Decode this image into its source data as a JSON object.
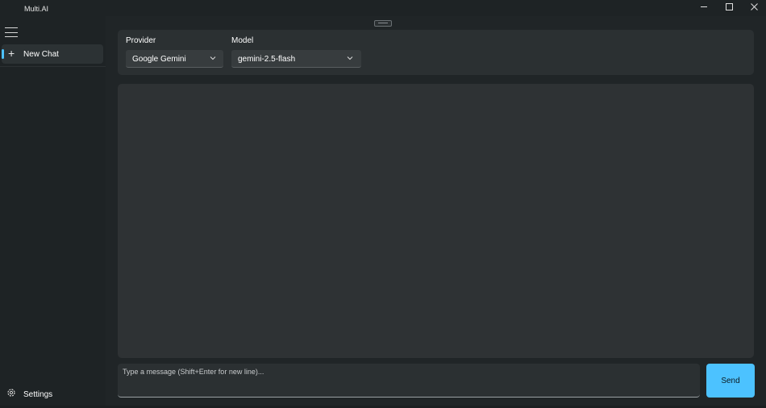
{
  "window": {
    "title": "Multi.AI"
  },
  "sidebar": {
    "items": [
      {
        "label": "New Chat",
        "icon": "plus-icon",
        "selected": true
      }
    ],
    "settings_label": "Settings"
  },
  "selectors": {
    "provider": {
      "label": "Provider",
      "value": "Google Gemini"
    },
    "model": {
      "label": "Model",
      "value": "gemini-2.5-flash"
    }
  },
  "composer": {
    "placeholder": "Type a message (Shift+Enter for new line)...",
    "send_label": "Send"
  },
  "colors": {
    "accent": "#4cc2ff",
    "background": "#1e2325",
    "card": "#2b3032"
  }
}
